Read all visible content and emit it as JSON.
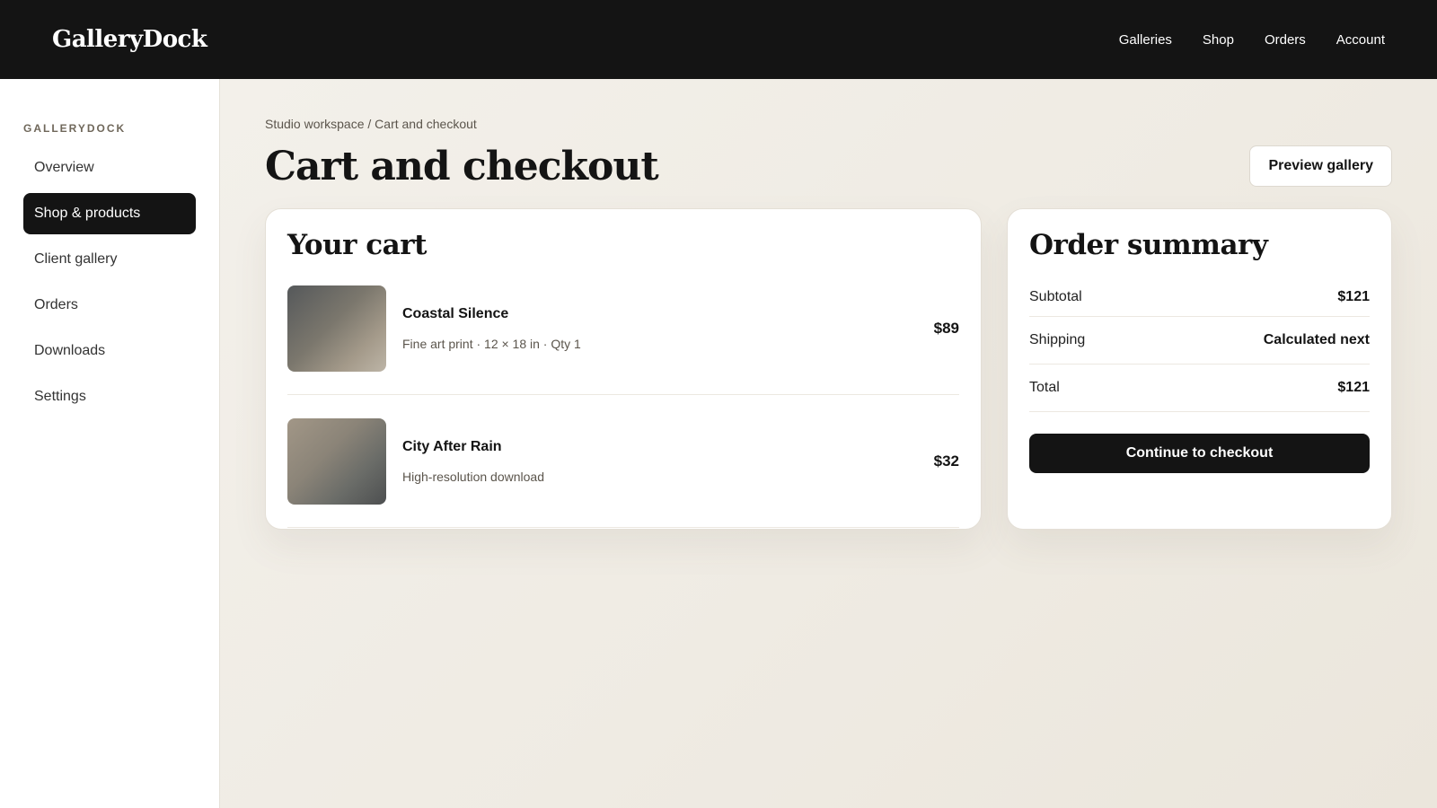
{
  "header": {
    "brand": "GalleryDock",
    "nav": [
      "Galleries",
      "Shop",
      "Orders",
      "Account"
    ]
  },
  "sidebar": {
    "eyebrow": "GALLERYDOCK",
    "items": [
      {
        "label": "Overview",
        "active": false
      },
      {
        "label": "Shop & products",
        "active": true
      },
      {
        "label": "Client gallery",
        "active": false
      },
      {
        "label": "Orders",
        "active": false
      },
      {
        "label": "Downloads",
        "active": false
      },
      {
        "label": "Settings",
        "active": false
      }
    ]
  },
  "main": {
    "breadcrumb": "Studio workspace / Cart and checkout",
    "title": "Cart and checkout",
    "preview_button": "Preview gallery"
  },
  "cart": {
    "title": "Your cart",
    "items": [
      {
        "name": "Coastal Silence",
        "meta": "Fine art print · 12 × 18 in · Qty 1",
        "price": "$89"
      },
      {
        "name": "City After Rain",
        "meta": "High-resolution download",
        "price": "$32"
      }
    ]
  },
  "summary": {
    "title": "Order summary",
    "rows": [
      {
        "label": "Subtotal",
        "value": "$121"
      },
      {
        "label": "Shipping",
        "value": "Calculated next"
      },
      {
        "label": "Total",
        "value": "$121"
      }
    ],
    "checkout_button": "Continue to checkout"
  },
  "colors": {
    "accent": "#141414",
    "background": "#f0ece4"
  }
}
